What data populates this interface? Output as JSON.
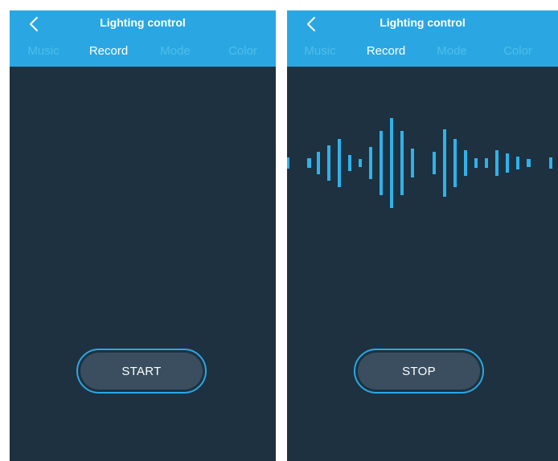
{
  "screens": [
    {
      "header": {
        "title": "Lighting control",
        "back_icon": "chevron-left-icon"
      },
      "tabs": [
        {
          "label": "Music",
          "active": false
        },
        {
          "label": "Record",
          "active": true
        },
        {
          "label": "Mode",
          "active": false
        },
        {
          "label": "Color",
          "active": false
        }
      ],
      "action_button": {
        "label": "START"
      },
      "waveform_visible": false
    },
    {
      "header": {
        "title": "Lighting control",
        "back_icon": "chevron-left-icon"
      },
      "tabs": [
        {
          "label": "Music",
          "active": false
        },
        {
          "label": "Record",
          "active": true
        },
        {
          "label": "Mode",
          "active": false
        },
        {
          "label": "Color",
          "active": false
        }
      ],
      "action_button": {
        "label": "STOP"
      },
      "waveform_visible": true
    }
  ],
  "colors": {
    "header_bg": "#2aa7e2",
    "inactive_tab": "#4ebde9",
    "active_tab": "#ffffff",
    "screen_bg": "#1d3140",
    "waveform": "#2fb2ea",
    "button_fill": "#3a4e5f",
    "button_ring": "#2aa7e2"
  }
}
